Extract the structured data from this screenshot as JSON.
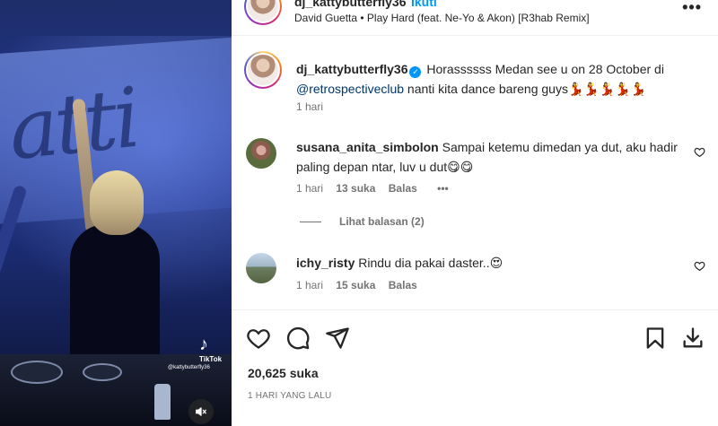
{
  "media": {
    "tiktok_glyph": "♪",
    "tiktok_label": "TikTok",
    "tiktok_handle": "@kattybutterfly36",
    "mute_icon": "speaker-muted-icon"
  },
  "header": {
    "username": "dj_kattybutterfly36",
    "follow_label": "Ikuti",
    "song": "David Guetta • Play Hard (feat. Ne-Yo & Akon) [R3hab Remix]",
    "more_label": "•••"
  },
  "caption": {
    "username": "dj_kattybutterfly36",
    "text_before": " Horassssss Medan see u on 28 October di ",
    "mention": "@retrospectiveclub",
    "text_after": " nanti kita dance bareng guys",
    "emojis": "💃💃💃💃💃",
    "time": "1 hari"
  },
  "comments": [
    {
      "username": "susana_anita_simbolon",
      "text": " Sampai ketemu dimedan ya dut, aku hadir paling depan ntar, luv u dut",
      "emojis": "😋😋",
      "time": "1 hari",
      "likes": "13 suka",
      "reply": "Balas",
      "more": "•••"
    },
    {
      "username": "ichy_risty",
      "text": " Rindu dia pakai daster..",
      "emojis": "😍",
      "time": "1 hari",
      "likes": "15 suka",
      "reply": "Balas"
    }
  ],
  "view_replies": "Lihat balasan (2)",
  "footer": {
    "likes": "20,625 suka",
    "date": "1 HARI YANG LALU"
  },
  "colors": {
    "accent": "#0095f6",
    "mention": "#00376b",
    "muted_text": "#737373",
    "primary_text": "#262626"
  }
}
